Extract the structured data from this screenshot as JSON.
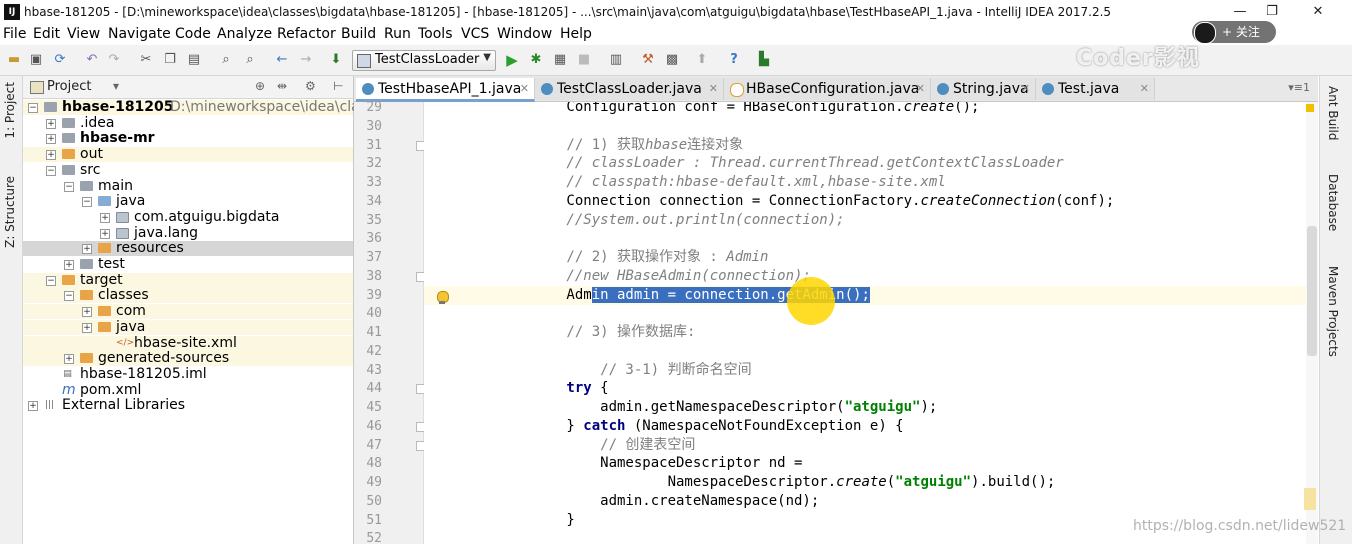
{
  "window": {
    "title": "hbase-181205 - [D:\\mineworkspace\\idea\\classes\\bigdata\\hbase-181205] - [hbase-181205] - ...\\src\\main\\java\\com\\atguigu\\bigdata\\hbase\\TestHbaseAPI_1.java - IntelliJ IDEA 2017.2.5",
    "logo": "IJ",
    "controls": [
      "—",
      "❐",
      "✕"
    ]
  },
  "menu": [
    "File",
    "Edit",
    "View",
    "Navigate",
    "Code",
    "Analyze",
    "Refactor",
    "Build",
    "Run",
    "Tools",
    "VCS",
    "Window",
    "Help"
  ],
  "toolbar": {
    "run_config": "TestClassLoader",
    "icons": [
      "folder-icon",
      "save-icon",
      "sync-icon",
      "undo-icon",
      "redo-icon",
      "cut-icon",
      "copy-icon",
      "paste-icon",
      "find-icon",
      "replace-icon",
      "back-icon",
      "forward-icon",
      "build-icon",
      "run-icon",
      "debug-icon",
      "coverage-icon",
      "stop-icon",
      "project-structure-icon",
      "settings-icon",
      "sdk-icon",
      "vcs-icon",
      "help-icon",
      "plugin-icon"
    ]
  },
  "overlay": {
    "watermark_top": "Coder影视",
    "follow_label": "+ 关注",
    "watermark_bottom": "https://blog.csdn.net/lidew521"
  },
  "left_strip": {
    "tabs": [
      "1: Project",
      "Z: Structure"
    ]
  },
  "project_panel": {
    "title": "Project",
    "tree": [
      {
        "label": "hbase-181205",
        "path": "D:\\mineworkspace\\idea\\clas",
        "depth": 0,
        "icon": "gray",
        "bold": true,
        "expanded": true,
        "bg": "yellow"
      },
      {
        "label": ".idea",
        "depth": 1,
        "icon": "gray",
        "expanded": false,
        "bg": ""
      },
      {
        "label": "hbase-mr",
        "depth": 1,
        "icon": "gray",
        "bold": true,
        "expanded": false,
        "bg": ""
      },
      {
        "label": "out",
        "depth": 1,
        "icon": "orange",
        "expanded": false,
        "bg": "yellow"
      },
      {
        "label": "src",
        "depth": 1,
        "icon": "gray",
        "expanded": true,
        "bg": ""
      },
      {
        "label": "main",
        "depth": 2,
        "icon": "gray",
        "expanded": true,
        "bg": ""
      },
      {
        "label": "java",
        "depth": 3,
        "icon": "blue",
        "expanded": true,
        "bg": ""
      },
      {
        "label": "com.atguigu.bigdata",
        "depth": 4,
        "icon": "pkg",
        "expanded": false,
        "bg": ""
      },
      {
        "label": "java.lang",
        "depth": 4,
        "icon": "pkg",
        "expanded": false,
        "bg": ""
      },
      {
        "label": "resources",
        "depth": 3,
        "icon": "orange",
        "expanded": false,
        "bg": "sel"
      },
      {
        "label": "test",
        "depth": 2,
        "icon": "gray",
        "expanded": false,
        "bg": ""
      },
      {
        "label": "target",
        "depth": 1,
        "icon": "orange",
        "expanded": true,
        "bg": "yellow"
      },
      {
        "label": "classes",
        "depth": 2,
        "icon": "orange",
        "expanded": true,
        "bg": "yellow"
      },
      {
        "label": "com",
        "depth": 3,
        "icon": "orange",
        "expanded": false,
        "bg": "yellow"
      },
      {
        "label": "java",
        "depth": 3,
        "icon": "orange",
        "expanded": false,
        "bg": "yellow"
      },
      {
        "label": "hbase-site.xml",
        "depth": 4,
        "icon": "xml",
        "bg": "yellow"
      },
      {
        "label": "generated-sources",
        "depth": 2,
        "icon": "orange",
        "expanded": false,
        "bg": "yellow"
      },
      {
        "label": "hbase-181205.iml",
        "depth": 1,
        "icon": "iml",
        "bg": ""
      },
      {
        "label": "pom.xml",
        "depth": 1,
        "icon": "maven",
        "bg": ""
      },
      {
        "label": "External Libraries",
        "depth": 0,
        "icon": "lib",
        "expanded": false,
        "bg": ""
      }
    ]
  },
  "editor": {
    "tabs": [
      {
        "label": "TestHbaseAPI_1.java",
        "active": true,
        "icon": "blue"
      },
      {
        "label": "TestClassLoader.java",
        "active": false,
        "icon": "blue"
      },
      {
        "label": "HBaseConfiguration.java",
        "active": false,
        "icon": "orange"
      },
      {
        "label": "String.java",
        "active": false,
        "icon": "blue"
      },
      {
        "label": "Test.java",
        "active": false,
        "icon": "blue"
      }
    ],
    "tab_menu": "▾≡1",
    "current_line": 39,
    "lines": [
      {
        "num": "29",
        "segs": [
          [
            "",
            "        Configuration conf = HBaseConfiguration."
          ],
          [
            "it",
            "create"
          ],
          [
            "",
            "();"
          ]
        ]
      },
      {
        "num": "30",
        "segs": [
          [
            "",
            ""
          ]
        ]
      },
      {
        "num": "31",
        "segs": [
          [
            "cmn",
            "        // 1) 获取"
          ],
          [
            "cm",
            "hbase"
          ],
          [
            "cmn",
            "连接对象"
          ]
        ]
      },
      {
        "num": "32",
        "segs": [
          [
            "cm",
            "        // classLoader : Thread.currentThread.getContextClassLoader"
          ]
        ]
      },
      {
        "num": "33",
        "segs": [
          [
            "cm",
            "        // classpath:hbase-default.xml,hbase-site.xml"
          ]
        ]
      },
      {
        "num": "34",
        "segs": [
          [
            "",
            "        Connection connection = ConnectionFactory."
          ],
          [
            "it",
            "createConnection"
          ],
          [
            "",
            "(conf);"
          ]
        ]
      },
      {
        "num": "35",
        "segs": [
          [
            "cm",
            "        //System.out.println(connection);"
          ]
        ]
      },
      {
        "num": "36",
        "segs": [
          [
            "",
            ""
          ]
        ]
      },
      {
        "num": "37",
        "segs": [
          [
            "cmn",
            "        // 2) 获取操作对象 : "
          ],
          [
            "cm",
            "Admin"
          ]
        ]
      },
      {
        "num": "38",
        "segs": [
          [
            "cm",
            "        //new HBaseAdmin(connection);"
          ]
        ]
      },
      {
        "num": "39",
        "segs": [
          [
            "",
            "        Adm"
          ],
          [
            "sel-text",
            "in admin = connection.getAdmin();"
          ]
        ]
      },
      {
        "num": "40",
        "segs": [
          [
            "",
            ""
          ]
        ]
      },
      {
        "num": "41",
        "segs": [
          [
            "cmn",
            "        // 3) 操作数据库:"
          ]
        ]
      },
      {
        "num": "42",
        "segs": [
          [
            "",
            ""
          ]
        ]
      },
      {
        "num": "43",
        "segs": [
          [
            "cmn",
            "            // 3-1) 判断命名空间"
          ]
        ]
      },
      {
        "num": "44",
        "segs": [
          [
            "kw",
            "        try"
          ],
          [
            "",
            " {"
          ]
        ]
      },
      {
        "num": "45",
        "segs": [
          [
            "",
            "            admin.getNamespaceDescriptor("
          ],
          [
            "st",
            "\"atguigu\""
          ],
          [
            "",
            ");"
          ]
        ]
      },
      {
        "num": "46",
        "segs": [
          [
            "",
            "        } "
          ],
          [
            "kw",
            "catch"
          ],
          [
            "",
            " (NamespaceNotFoundException e) {"
          ]
        ]
      },
      {
        "num": "47",
        "segs": [
          [
            "cmn",
            "            // 创建表空间"
          ]
        ]
      },
      {
        "num": "48",
        "segs": [
          [
            "",
            "            NamespaceDescriptor nd ="
          ]
        ]
      },
      {
        "num": "49",
        "segs": [
          [
            "",
            "                    NamespaceDescriptor."
          ],
          [
            "it",
            "create"
          ],
          [
            "",
            "("
          ],
          [
            "st",
            "\"atguigu\""
          ],
          [
            "",
            ").build();"
          ]
        ]
      },
      {
        "num": "50",
        "segs": [
          [
            "",
            "            admin.createNamespace(nd);"
          ]
        ]
      },
      {
        "num": "51",
        "segs": [
          [
            "",
            "        }"
          ]
        ]
      },
      {
        "num": "52",
        "segs": [
          [
            "",
            ""
          ]
        ]
      }
    ]
  },
  "right_strip": {
    "tabs": [
      "Ant Build",
      "Database",
      "Maven Projects"
    ]
  }
}
